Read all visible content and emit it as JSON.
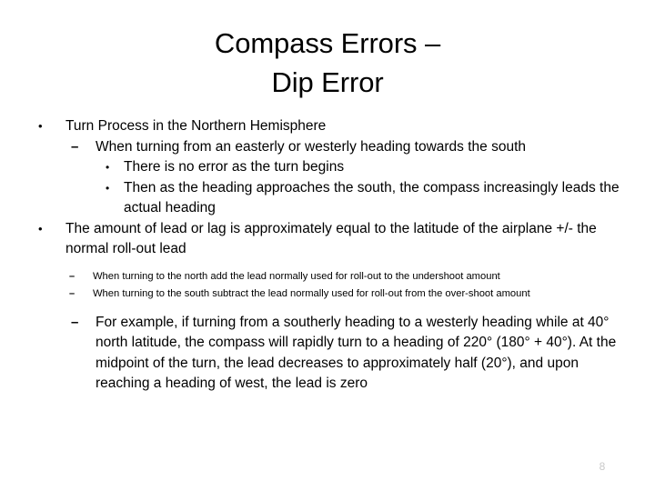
{
  "slide": {
    "page_number": "8",
    "background_color": "#ffffff",
    "text_color": "#000000",
    "page_number_color": "#c9c9c9",
    "title": "Compass Errors –\nDip Error",
    "title_lines": [
      "Compass Errors –",
      "Dip Error"
    ]
  },
  "bullets": {
    "b1": {
      "marker": "•",
      "text": "Turn Process in the Northern Hemisphere"
    },
    "b2": {
      "marker": "–",
      "text": "When turning from an easterly or westerly heading towards the south"
    },
    "b3": {
      "marker": "•",
      "text": "There is no error as the turn begins"
    },
    "b4": {
      "marker": "•",
      "text": "Then as the heading approaches the south, the compass increasingly leads the actual heading"
    },
    "b5": {
      "marker": "•",
      "text": "The amount of lead or lag is approximately equal to the latitude of the airplane +/- the normal roll-out lead"
    },
    "b6": {
      "marker": "–",
      "text": "When turning to the north add the lead normally used for roll-out to the undershoot amount"
    },
    "b7": {
      "marker": "–",
      "text": "When turning to the south subtract the lead normally used for roll-out from the over-shoot amount"
    },
    "b8": {
      "marker": "–",
      "text": "For example, if turning from a southerly heading to a westerly heading while at 40° north latitude, the compass will rapidly turn to a heading of 220° (180° + 40°).  At the midpoint of the turn, the lead decreases to approximately half (20°), and upon reaching a heading of west, the lead is zero"
    }
  }
}
